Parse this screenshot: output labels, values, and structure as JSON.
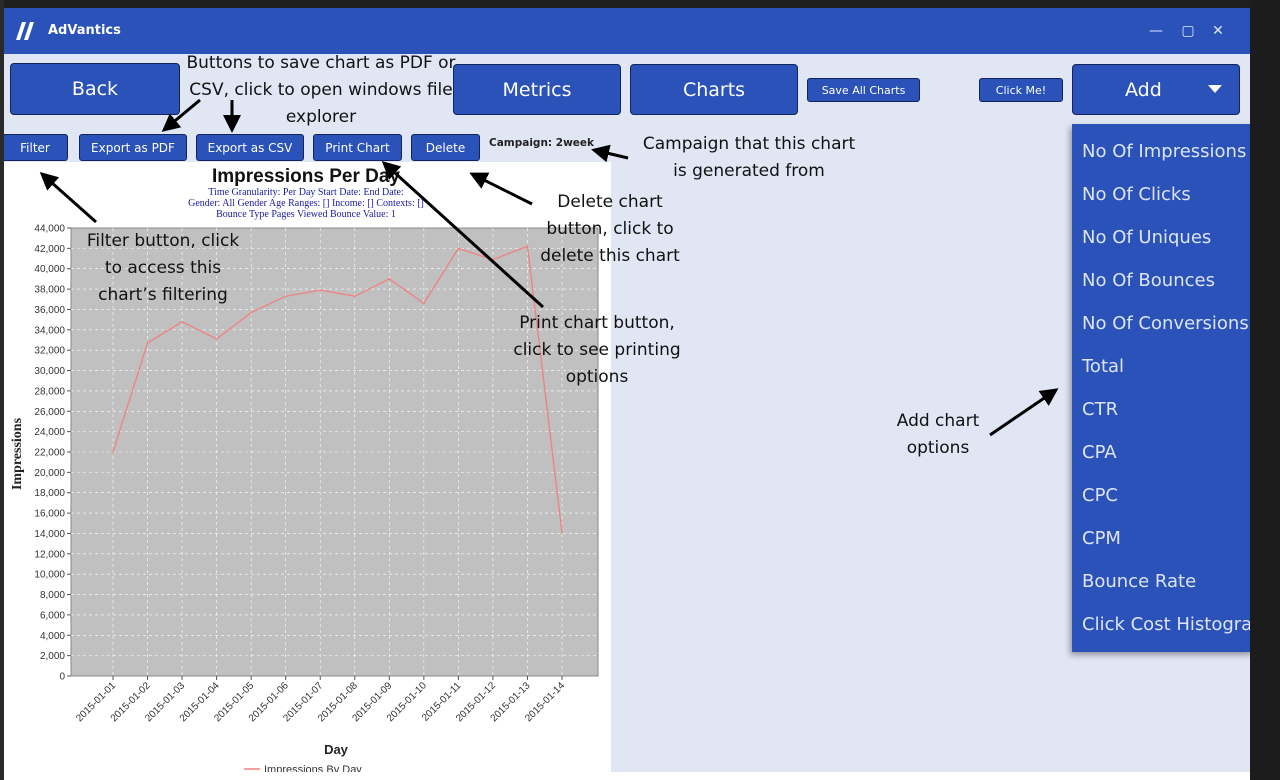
{
  "app": {
    "title": "AdVantics",
    "window_controls": {
      "minimize": "—",
      "maximize": "▢",
      "close": "✕"
    }
  },
  "top_buttons": {
    "back": "Back",
    "metrics": "Metrics",
    "charts": "Charts",
    "save_all": "Save All Charts",
    "click_me": "Click Me!",
    "add": "Add"
  },
  "toolbar": {
    "filter": "Filter",
    "export_pdf": "Export as PDF",
    "export_csv": "Export as CSV",
    "print_chart": "Print Chart",
    "delete": "Delete",
    "campaign": "Campaign: 2week"
  },
  "add_menu": {
    "items": [
      "No Of Impressions",
      "No Of Clicks",
      "No Of Uniques",
      "No Of Bounces",
      "No Of Conversions",
      "Total",
      "CTR",
      "CPA",
      "CPC",
      "CPM",
      "Bounce Rate",
      "Click Cost Histogram"
    ]
  },
  "chart_data": {
    "type": "line",
    "title": "Impressions Per Day",
    "subtitle_lines": [
      "Time Granularity: Per Day   Start Date:    End Date:",
      "Gender: All Gender   Age Ranges: []   Income: []   Contexts: []",
      "Bounce Type Pages Viewed   Bounce Value: 1"
    ],
    "xlabel": "Day",
    "ylabel": "Impressions",
    "ylim": [
      0,
      44000
    ],
    "y_ticks": [
      "0",
      "2,000",
      "4,000",
      "6,000",
      "8,000",
      "10,000",
      "12,000",
      "14,000",
      "16,000",
      "18,000",
      "20,000",
      "22,000",
      "24,000",
      "26,000",
      "28,000",
      "30,000",
      "32,000",
      "34,000",
      "36,000",
      "38,000",
      "40,000",
      "42,000",
      "44,000"
    ],
    "categories": [
      "2015-01-01",
      "2015-01-02",
      "2015-01-03",
      "2015-01-04",
      "2015-01-05",
      "2015-01-06",
      "2015-01-07",
      "2015-01-08",
      "2015-01-09",
      "2015-01-10",
      "2015-01-11",
      "2015-01-12",
      "2015-01-13",
      "2015-01-14"
    ],
    "series": [
      {
        "name": "Impressions By Day",
        "color": "#f08080",
        "values": [
          22000,
          32700,
          34800,
          33100,
          35700,
          37300,
          37900,
          37300,
          39000,
          36600,
          42000,
          40900,
          42200,
          14100
        ]
      }
    ],
    "grid": true,
    "legend": "bottom"
  },
  "annotations": {
    "export_note": [
      "Buttons to save chart as PDF or",
      "CSV, click to open windows file",
      "explorer"
    ],
    "filter_note": [
      "Filter button, click",
      "to access this",
      "chart’s filtering"
    ],
    "campaign_note": [
      "Campaign that this chart",
      "is generated from"
    ],
    "delete_note": [
      "Delete chart",
      "button, click to",
      "delete this chart"
    ],
    "print_note": [
      "Print chart button,",
      "click to see printing",
      "options"
    ],
    "add_note": [
      "Add chart",
      "options"
    ]
  },
  "colors": {
    "primary": "#2a52b8",
    "window_bg": "#e1e6f5",
    "plot_bg": "#c0c0c0",
    "series": "#f08080",
    "chart_text": "#1a1aa0"
  }
}
